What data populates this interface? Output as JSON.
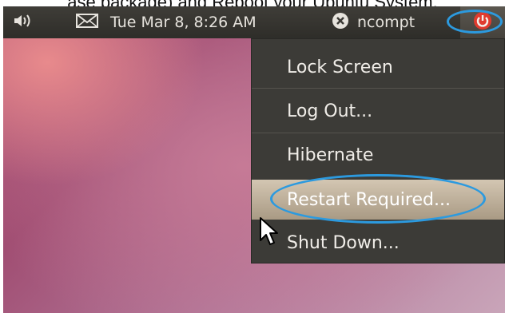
{
  "caption": "ase package) and Reboot your Ubuntu System.",
  "panel": {
    "clock": "Tue Mar  8,  8:26 AM",
    "user": "ncompt"
  },
  "menu": {
    "items": [
      {
        "label": "Lock Screen"
      },
      {
        "label": "Log Out..."
      },
      {
        "label": "Hibernate"
      },
      {
        "label": "Restart Required..."
      },
      {
        "label": "Shut Down..."
      }
    ],
    "highlighted_item": "Restart Required..."
  },
  "colors": {
    "annotation": "#2c9adf",
    "power_icon": "#e03b2e",
    "panel": "#3c3b37"
  },
  "icons": [
    "volume-icon",
    "mail-icon",
    "me-status-icon",
    "power-icon",
    "mouse-cursor-icon"
  ]
}
